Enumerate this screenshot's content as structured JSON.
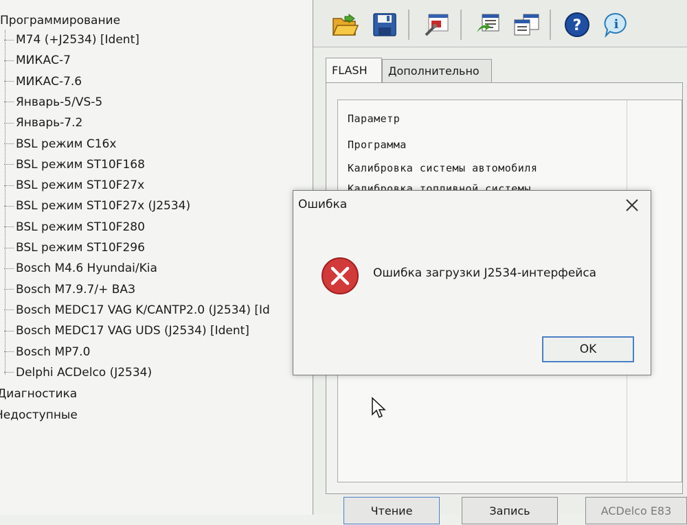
{
  "tree": {
    "root_label": "Программирование",
    "items": [
      "M74 (+J2534) [Ident]",
      "МИКАС-7",
      "МИКАС-7.6",
      "Январь-5/VS-5",
      "Январь-7.2",
      "BSL режим C16x",
      "BSL режим ST10F168",
      "BSL режим ST10F27x",
      "BSL режим ST10F27x (J2534)",
      "BSL режим ST10F280",
      "BSL режим ST10F296",
      "Bosch M4.6 Hyundai/Kia",
      "Bosch M7.9.7/+ ВАЗ",
      "Bosch MEDC17 VAG K/CANTP2.0 (J2534) [Id",
      "Bosch MEDC17 VAG UDS (J2534) [Ident]",
      "Bosch MP7.0",
      "Delphi ACDelco (J2534)"
    ],
    "other_roots": [
      "Диагностика",
      "Недоступные"
    ]
  },
  "toolbar": {
    "icons": [
      "open-folder-icon",
      "save-disk-icon",
      "settings-tools-icon",
      "load-file-icon",
      "compare-file-icon",
      "help-icon",
      "info-icon"
    ]
  },
  "tabs": [
    "FLASH",
    "Дополнительно"
  ],
  "grid": {
    "rows": [
      "Параметр",
      "Программа",
      "Калибровка системы автомобиля",
      "Калибровка топливной системы"
    ]
  },
  "bottom_buttons": [
    "Чтение",
    "Запись",
    "ACDelco E83"
  ],
  "dialog": {
    "title": "Ошибка",
    "message": "Ошибка загрузки J2534-интерфейса",
    "ok_label": "OK"
  },
  "colors": {
    "error_icon": "#d23a3a",
    "ok_focus": "#4a7fc6"
  }
}
